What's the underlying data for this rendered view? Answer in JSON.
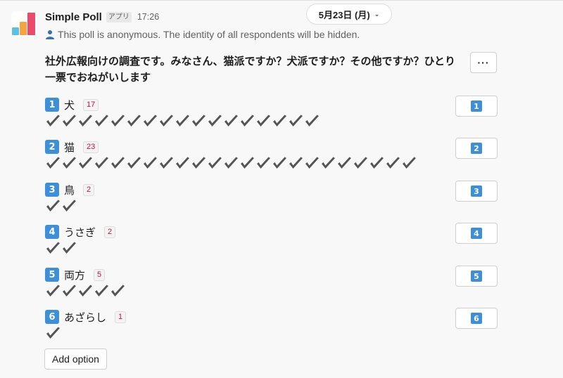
{
  "message": {
    "app_name": "Simple Poll",
    "app_badge": "アプリ",
    "time": "17:26",
    "date_divider": "5月23日 (月)",
    "anonymous_notice": "This poll is anonymous. The identity of all respondents will be hidden.",
    "question": "社外広報向けの調査です。みなさん、猫派ですか？犬派ですか？その他ですか？ひとり一票でおねがいします",
    "more_button_label": "···"
  },
  "options": [
    {
      "number": "1",
      "label": "犬",
      "count": "17",
      "votes": 17
    },
    {
      "number": "2",
      "label": "猫",
      "count": "23",
      "votes": 23
    },
    {
      "number": "3",
      "label": "鳥",
      "count": "2",
      "votes": 2
    },
    {
      "number": "4",
      "label": "うさぎ",
      "count": "2",
      "votes": 2
    },
    {
      "number": "5",
      "label": "両方",
      "count": "5",
      "votes": 5
    },
    {
      "number": "6",
      "label": "あざらし",
      "count": "1",
      "votes": 1
    }
  ],
  "add_option_label": "Add option",
  "icons": {
    "person": "person-icon",
    "check": "heavy-check-icon",
    "chevron": "chevron-down-icon"
  },
  "colors": {
    "keycap": "#3d8fd9",
    "count_text": "#c01343",
    "check": "#545454"
  }
}
